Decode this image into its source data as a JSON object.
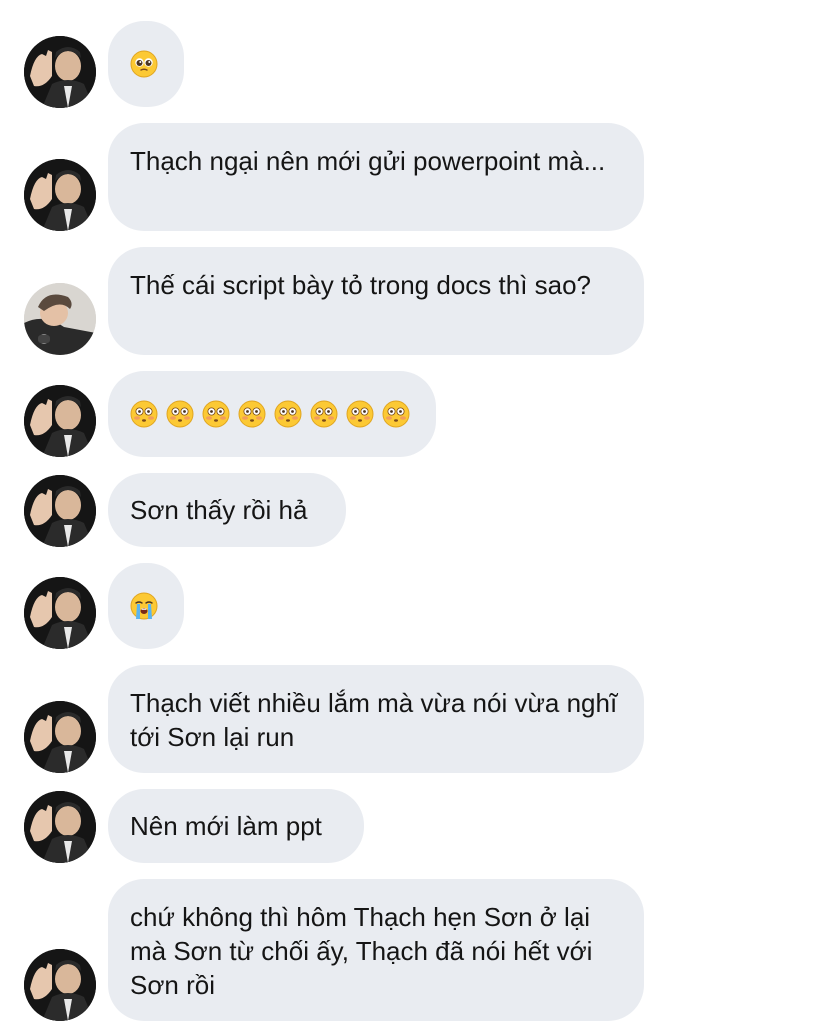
{
  "messages": [
    {
      "sender": "thach",
      "emoji": [
        "pleading-face"
      ]
    },
    {
      "sender": "thach",
      "text": "Thạch ngại nên mới gửi powerpoint mà..."
    },
    {
      "sender": "son",
      "text": "Thế cái script bày tỏ trong docs thì sao?"
    },
    {
      "sender": "thach",
      "emoji": [
        "flushed-face",
        "flushed-face",
        "flushed-face",
        "flushed-face",
        "flushed-face",
        "flushed-face",
        "flushed-face",
        "flushed-face"
      ]
    },
    {
      "sender": "thach",
      "text": "Sơn thấy rồi hả"
    },
    {
      "sender": "thach",
      "emoji": [
        "loudly-crying-face"
      ]
    },
    {
      "sender": "thach",
      "text": "Thạch viết nhiều lắm mà vừa nói vừa nghĩ tới Sơn lại run"
    },
    {
      "sender": "thach",
      "text": "Nên mới làm ppt"
    },
    {
      "sender": "thach",
      "text": "chứ không thì hôm Thạch hẹn Sơn ở lại mà Sơn từ chối ấy, Thạch đã nói hết với Sơn rồi"
    }
  ],
  "colors": {
    "bubble_bg": "#e9ecf1",
    "text": "#151515",
    "emoji_yellow": "#fcc934"
  }
}
